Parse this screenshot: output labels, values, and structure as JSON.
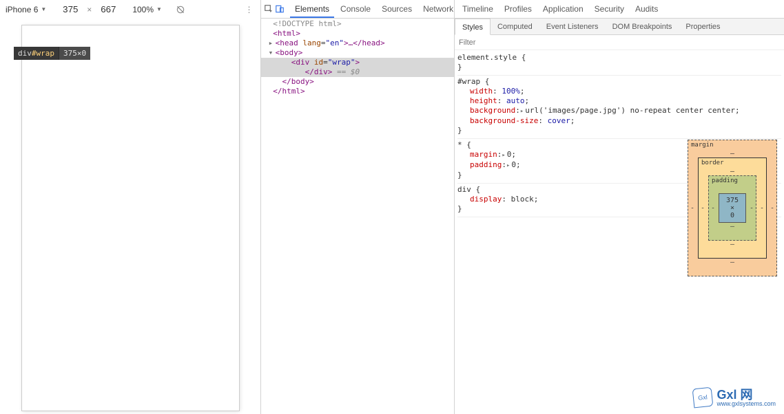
{
  "device_toolbar": {
    "device": "iPhone 6",
    "width": "375",
    "height": "667",
    "zoom": "100%",
    "rotate_icon": "rotate-icon",
    "menu_icon": "kebab-icon"
  },
  "hover_tooltip": {
    "selector_prefix": "div",
    "selector_id": "#wrap",
    "dimensions": "375×0"
  },
  "devtools": {
    "tabs": [
      "Elements",
      "Console",
      "Sources",
      "Network",
      "Timeline",
      "Profiles",
      "Application",
      "Security",
      "Audits"
    ],
    "active_tab": "Elements"
  },
  "dom": {
    "l0": "<!DOCTYPE html>",
    "l1_open": "<html>",
    "l2_head_open": "<head ",
    "l2_head_attr": "lang",
    "l2_head_val": "\"en\"",
    "l2_head_mid": ">…</head>",
    "l3_body_open": "<body>",
    "l4_div_open": "<div ",
    "l4_div_attr": "id",
    "l4_div_val": "\"wrap\"",
    "l4_div_close_open": ">",
    "l5_div_close": "</div>",
    "l5_sel": " == $0",
    "l6_body_close": "</body>",
    "l7_html_close": "</html>"
  },
  "styles_panel": {
    "tabs": [
      "Styles",
      "Computed",
      "Event Listeners",
      "DOM Breakpoints",
      "Properties"
    ],
    "active_tab": "Styles",
    "filter_placeholder": "Filter"
  },
  "rules": {
    "r0_sel": "element.style {",
    "r0_close": "}",
    "r1_sel": "#wrap {",
    "r1_p0n": "width",
    "r1_p0v": "100%",
    "r1_p1n": "height",
    "r1_p1v": "auto",
    "r1_p2n": "background",
    "r1_p2v_url": "'images/page.jpg'",
    "r1_p2v_rest": " no-repeat center center",
    "r1_p3n": "background-size",
    "r1_p3v": "cover",
    "r1_close": "}",
    "r2_sel": "* {",
    "r2_p0n": "margin",
    "r2_p0v": "0",
    "r2_p1n": "padding",
    "r2_p1v": "0",
    "r2_close": "}",
    "r3_sel": "div {",
    "r3_p0n": "display",
    "r3_p0v": "block",
    "r3_close": "}"
  },
  "box_model": {
    "margin_label": "margin",
    "border_label": "border",
    "padding_label": "padding",
    "content": "375 × 0",
    "dash": "–",
    "dash2": "-"
  },
  "watermark": {
    "badge": "Gxl",
    "line1": "Gxl 网",
    "line2": "www.gxlsystems.com"
  }
}
